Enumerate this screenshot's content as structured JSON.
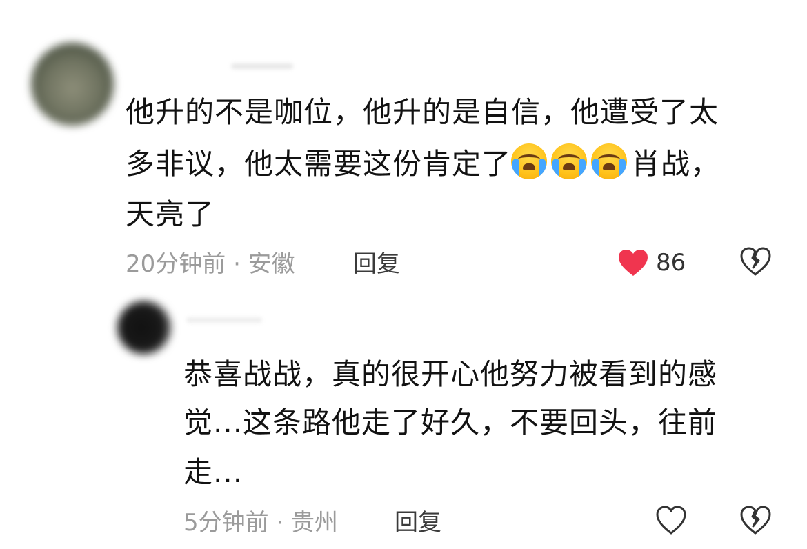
{
  "comments": [
    {
      "lines": [
        "他升的不是咖位，他升的是自信，他遭受了太",
        "多非议，他太需要这份肯定了",
        "天亮了"
      ],
      "line2_suffix": "肖战，",
      "emojis": [
        "crying-face-icon",
        "crying-face-icon",
        "crying-face-icon"
      ],
      "meta": "20分钟前 · 安徽",
      "reply_label": "回复",
      "like_count": "86",
      "liked": true
    },
    {
      "lines": [
        "恭喜战战，真的很开心他努力被看到的感",
        "觉...这条路他走了好久，不要回头，往前",
        "走..."
      ],
      "meta": "5分钟前 · 贵州",
      "reply_label": "回复",
      "liked": false
    }
  ],
  "colors": {
    "like_red": "#f0354f",
    "meta_gray": "#9b9b9b",
    "text": "#121212"
  }
}
